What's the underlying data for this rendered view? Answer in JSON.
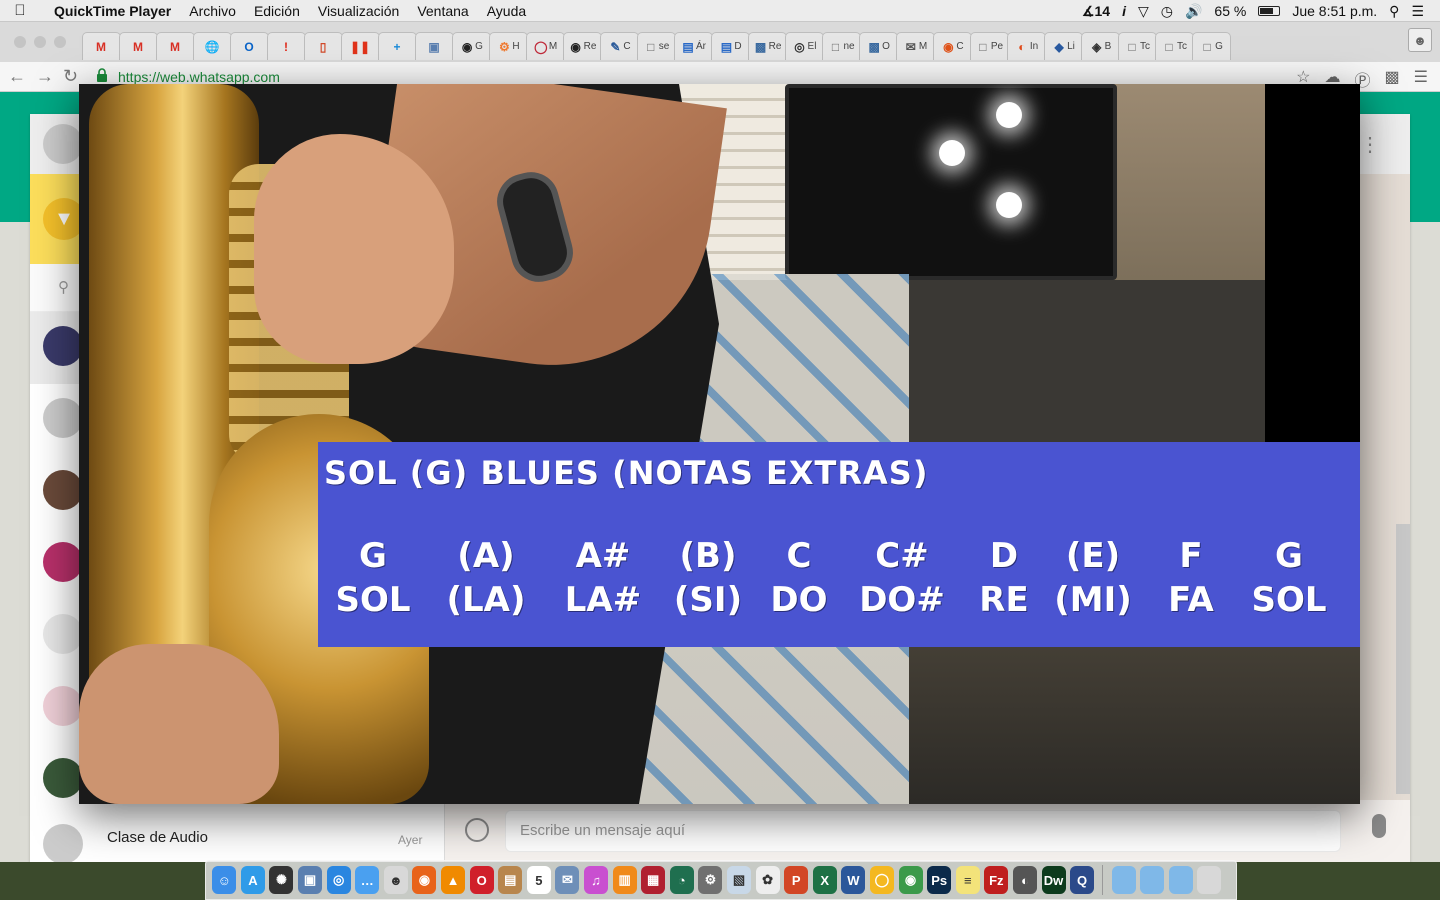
{
  "menubar": {
    "apple": "",
    "items": [
      "QuickTime Player",
      "Archivo",
      "Edición",
      "Visualización",
      "Ventana",
      "Ayuda"
    ],
    "status": {
      "adobe_count": "14",
      "battery": "65 %",
      "clock": "Jue 8:51 p.m."
    }
  },
  "browser": {
    "url": "https://web.whatsapp.com",
    "tabs": [
      {
        "icon": "gmail-icon",
        "label": ""
      },
      {
        "icon": "gmail-icon",
        "label": ""
      },
      {
        "icon": "gmail-icon",
        "label": ""
      },
      {
        "icon": "globe-icon",
        "label": ""
      },
      {
        "icon": "outlook-icon",
        "label": ""
      },
      {
        "icon": "alert-icon",
        "label": ""
      },
      {
        "icon": "page-icon",
        "label": ""
      },
      {
        "icon": "pause-icon",
        "label": ""
      },
      {
        "icon": "plus-icon",
        "label": ""
      },
      {
        "icon": "window-icon",
        "label": ""
      },
      {
        "icon": "github-icon",
        "label": "G"
      },
      {
        "icon": "hubspot-icon",
        "label": "H"
      },
      {
        "icon": "ring-icon",
        "label": "M"
      },
      {
        "icon": "github-icon",
        "label": "Re"
      },
      {
        "icon": "edit-icon",
        "label": "C"
      },
      {
        "icon": "doc-icon",
        "label": "se"
      },
      {
        "icon": "chat-icon",
        "label": "Ár"
      },
      {
        "icon": "chat-icon",
        "label": "D"
      },
      {
        "icon": "app-icon",
        "label": "Re"
      },
      {
        "icon": "circle-icon",
        "label": "El"
      },
      {
        "icon": "doc-icon",
        "label": "ne"
      },
      {
        "icon": "app-icon",
        "label": "O"
      },
      {
        "icon": "mail-icon",
        "label": "M"
      },
      {
        "icon": "orange-icon",
        "label": "C"
      },
      {
        "icon": "doc-icon",
        "label": "Pe"
      },
      {
        "icon": "loader-icon",
        "label": "In"
      },
      {
        "icon": "hat-icon",
        "label": "Li"
      },
      {
        "icon": "cube-icon",
        "label": "B"
      },
      {
        "icon": "doc-icon",
        "label": "Tc"
      },
      {
        "icon": "doc-icon",
        "label": "Tc"
      },
      {
        "icon": "doc-icon",
        "label": "G"
      }
    ]
  },
  "whatsapp": {
    "chat_preview_title": "Clase de Audio",
    "chat_preview_time": "Ayer",
    "message_placeholder": "Escribe un mensaje aquí"
  },
  "video_overlay": {
    "title": "SOL (G) BLUES (NOTAS EXTRAS)",
    "notes": [
      {
        "en": "G",
        "es": "SOL"
      },
      {
        "en": "(A)",
        "es": "(LA)"
      },
      {
        "en": "A#",
        "es": "LA#"
      },
      {
        "en": "(B)",
        "es": "(SI)"
      },
      {
        "en": "C",
        "es": "DO"
      },
      {
        "en": "C#",
        "es": "DO#"
      },
      {
        "en": "D",
        "es": "RE"
      },
      {
        "en": "(E)",
        "es": "(MI)"
      },
      {
        "en": "F",
        "es": "FA"
      },
      {
        "en": "G",
        "es": "SOL"
      }
    ],
    "colors": {
      "banner": "#4a54d1",
      "text": "#ffffff"
    }
  },
  "dock": {
    "apps": [
      {
        "name": "finder-icon",
        "color": "#3b8ee8",
        "glyph": "☺"
      },
      {
        "name": "app-store-icon",
        "color": "#2f9be8",
        "glyph": "A"
      },
      {
        "name": "launchpad-icon",
        "color": "#333333",
        "glyph": "✺"
      },
      {
        "name": "preview-icon",
        "color": "#5a7fb0",
        "glyph": "▣"
      },
      {
        "name": "safari-icon",
        "color": "#2a86e0",
        "glyph": "◎"
      },
      {
        "name": "messages-icon",
        "color": "#4aa0f0",
        "glyph": "…"
      },
      {
        "name": "photo-booth-icon",
        "color": "#d8d8d8",
        "glyph": "☻"
      },
      {
        "name": "firefox-icon",
        "color": "#e8631a",
        "glyph": "◉"
      },
      {
        "name": "vlc-icon",
        "color": "#f08a00",
        "glyph": "▲"
      },
      {
        "name": "opera-icon",
        "color": "#d0202a",
        "glyph": "O"
      },
      {
        "name": "contacts-icon",
        "color": "#b8864d",
        "glyph": "▤"
      },
      {
        "name": "calendar-icon",
        "color": "#ffffff",
        "glyph": "5"
      },
      {
        "name": "mail-app-icon",
        "color": "#6e8fb8",
        "glyph": "✉"
      },
      {
        "name": "itunes-icon",
        "color": "#c94fd0",
        "glyph": "♫"
      },
      {
        "name": "ibooks-icon",
        "color": "#f08a1a",
        "glyph": "▥"
      },
      {
        "name": "photos-grid-icon",
        "color": "#b02030",
        "glyph": "▦"
      },
      {
        "name": "time-machine-icon",
        "color": "#1f6f4f",
        "glyph": "◔"
      },
      {
        "name": "system-prefs-icon",
        "color": "#707070",
        "glyph": "⚙"
      },
      {
        "name": "utility-icon",
        "color": "#c8d8e8",
        "glyph": "▧"
      },
      {
        "name": "photos-icon",
        "color": "#eeeeee",
        "glyph": "✿"
      },
      {
        "name": "powerpoint-icon",
        "color": "#d24625",
        "glyph": "P"
      },
      {
        "name": "excel-icon",
        "color": "#1e7145",
        "glyph": "X"
      },
      {
        "name": "word-icon",
        "color": "#2b579a",
        "glyph": "W"
      },
      {
        "name": "shopping-icon",
        "color": "#f4b820",
        "glyph": "◯"
      },
      {
        "name": "chrome-icon",
        "color": "#3b9a4a",
        "glyph": "◉"
      },
      {
        "name": "photoshop-icon",
        "color": "#0b2a4a",
        "glyph": "Ps"
      },
      {
        "name": "notes-icon",
        "color": "#f3e37a",
        "glyph": "≡"
      },
      {
        "name": "filezilla-icon",
        "color": "#bf1e1e",
        "glyph": "Fz"
      },
      {
        "name": "github-desktop-icon",
        "color": "#555555",
        "glyph": "◐"
      },
      {
        "name": "dreamweaver-icon",
        "color": "#0d3b1d",
        "glyph": "Dw"
      },
      {
        "name": "quicktime-icon",
        "color": "#2b4a8a",
        "glyph": "Q"
      }
    ],
    "folders": [
      {
        "name": "downloads-folder-icon",
        "color": "#7fb8e8"
      },
      {
        "name": "apps-folder-icon",
        "color": "#7fb8e8"
      },
      {
        "name": "documents-folder-icon",
        "color": "#7fb8e8"
      },
      {
        "name": "trash-icon",
        "color": "#d8d8d8"
      }
    ]
  }
}
